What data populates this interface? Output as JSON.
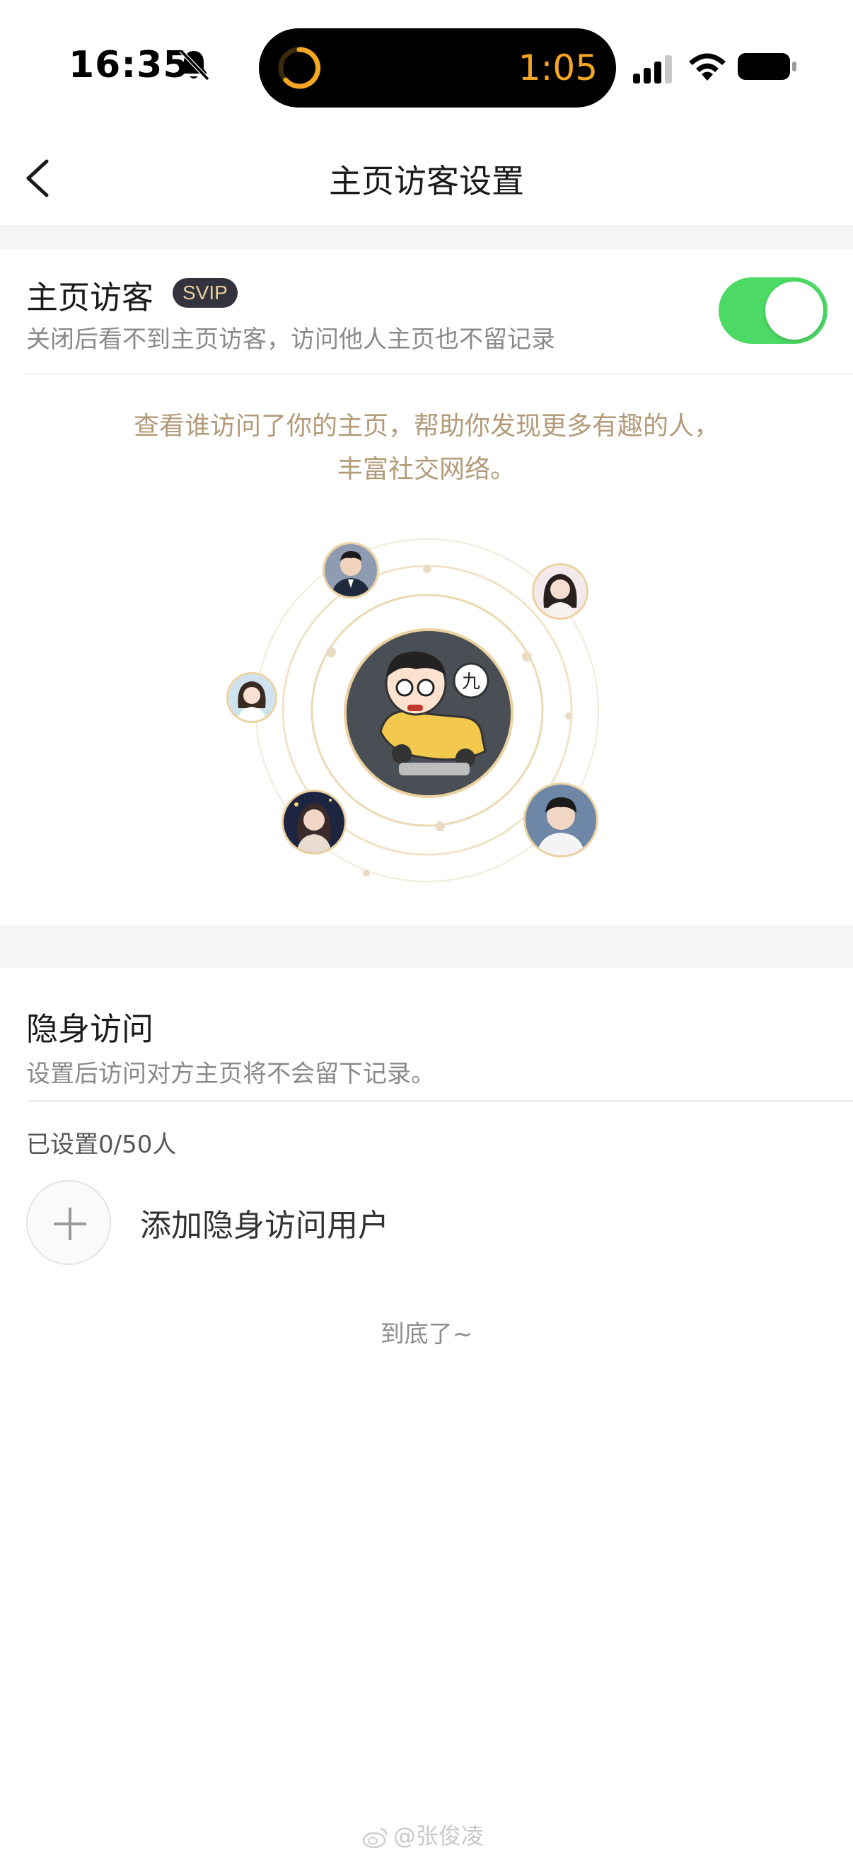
{
  "status_bar": {
    "time": "16:35",
    "activity_timer": "1:05",
    "icons": [
      "bell-slash-icon",
      "timer-ring-icon",
      "cellular-signal-icon",
      "wifi-icon",
      "battery-icon"
    ]
  },
  "nav": {
    "title": "主页访客设置",
    "back_icon": "chevron-left-icon"
  },
  "visitors": {
    "title": "主页访客",
    "badge": "SVIP",
    "description": "关闭后看不到主页访客，访问他人主页也不留记录",
    "toggle_on": true,
    "promo_line1": "查看谁访问了你的主页，帮助你发现更多有趣的人，",
    "promo_line2": "丰富社交网络。",
    "center_avatar_text": "九"
  },
  "stealth": {
    "title": "隐身访问",
    "description": "设置后访问对方主页将不会留下记录。",
    "count_text": "已设置0/50人",
    "add_label": "添加隐身访问用户",
    "end_text": "到底了~"
  },
  "watermark": "@张俊凌",
  "colors": {
    "toggle_on": "#4cd964",
    "promo_text": "#b39b79",
    "timer": "#f5a623",
    "badge_bg": "#33333f",
    "badge_text": "#e9cf9a"
  }
}
